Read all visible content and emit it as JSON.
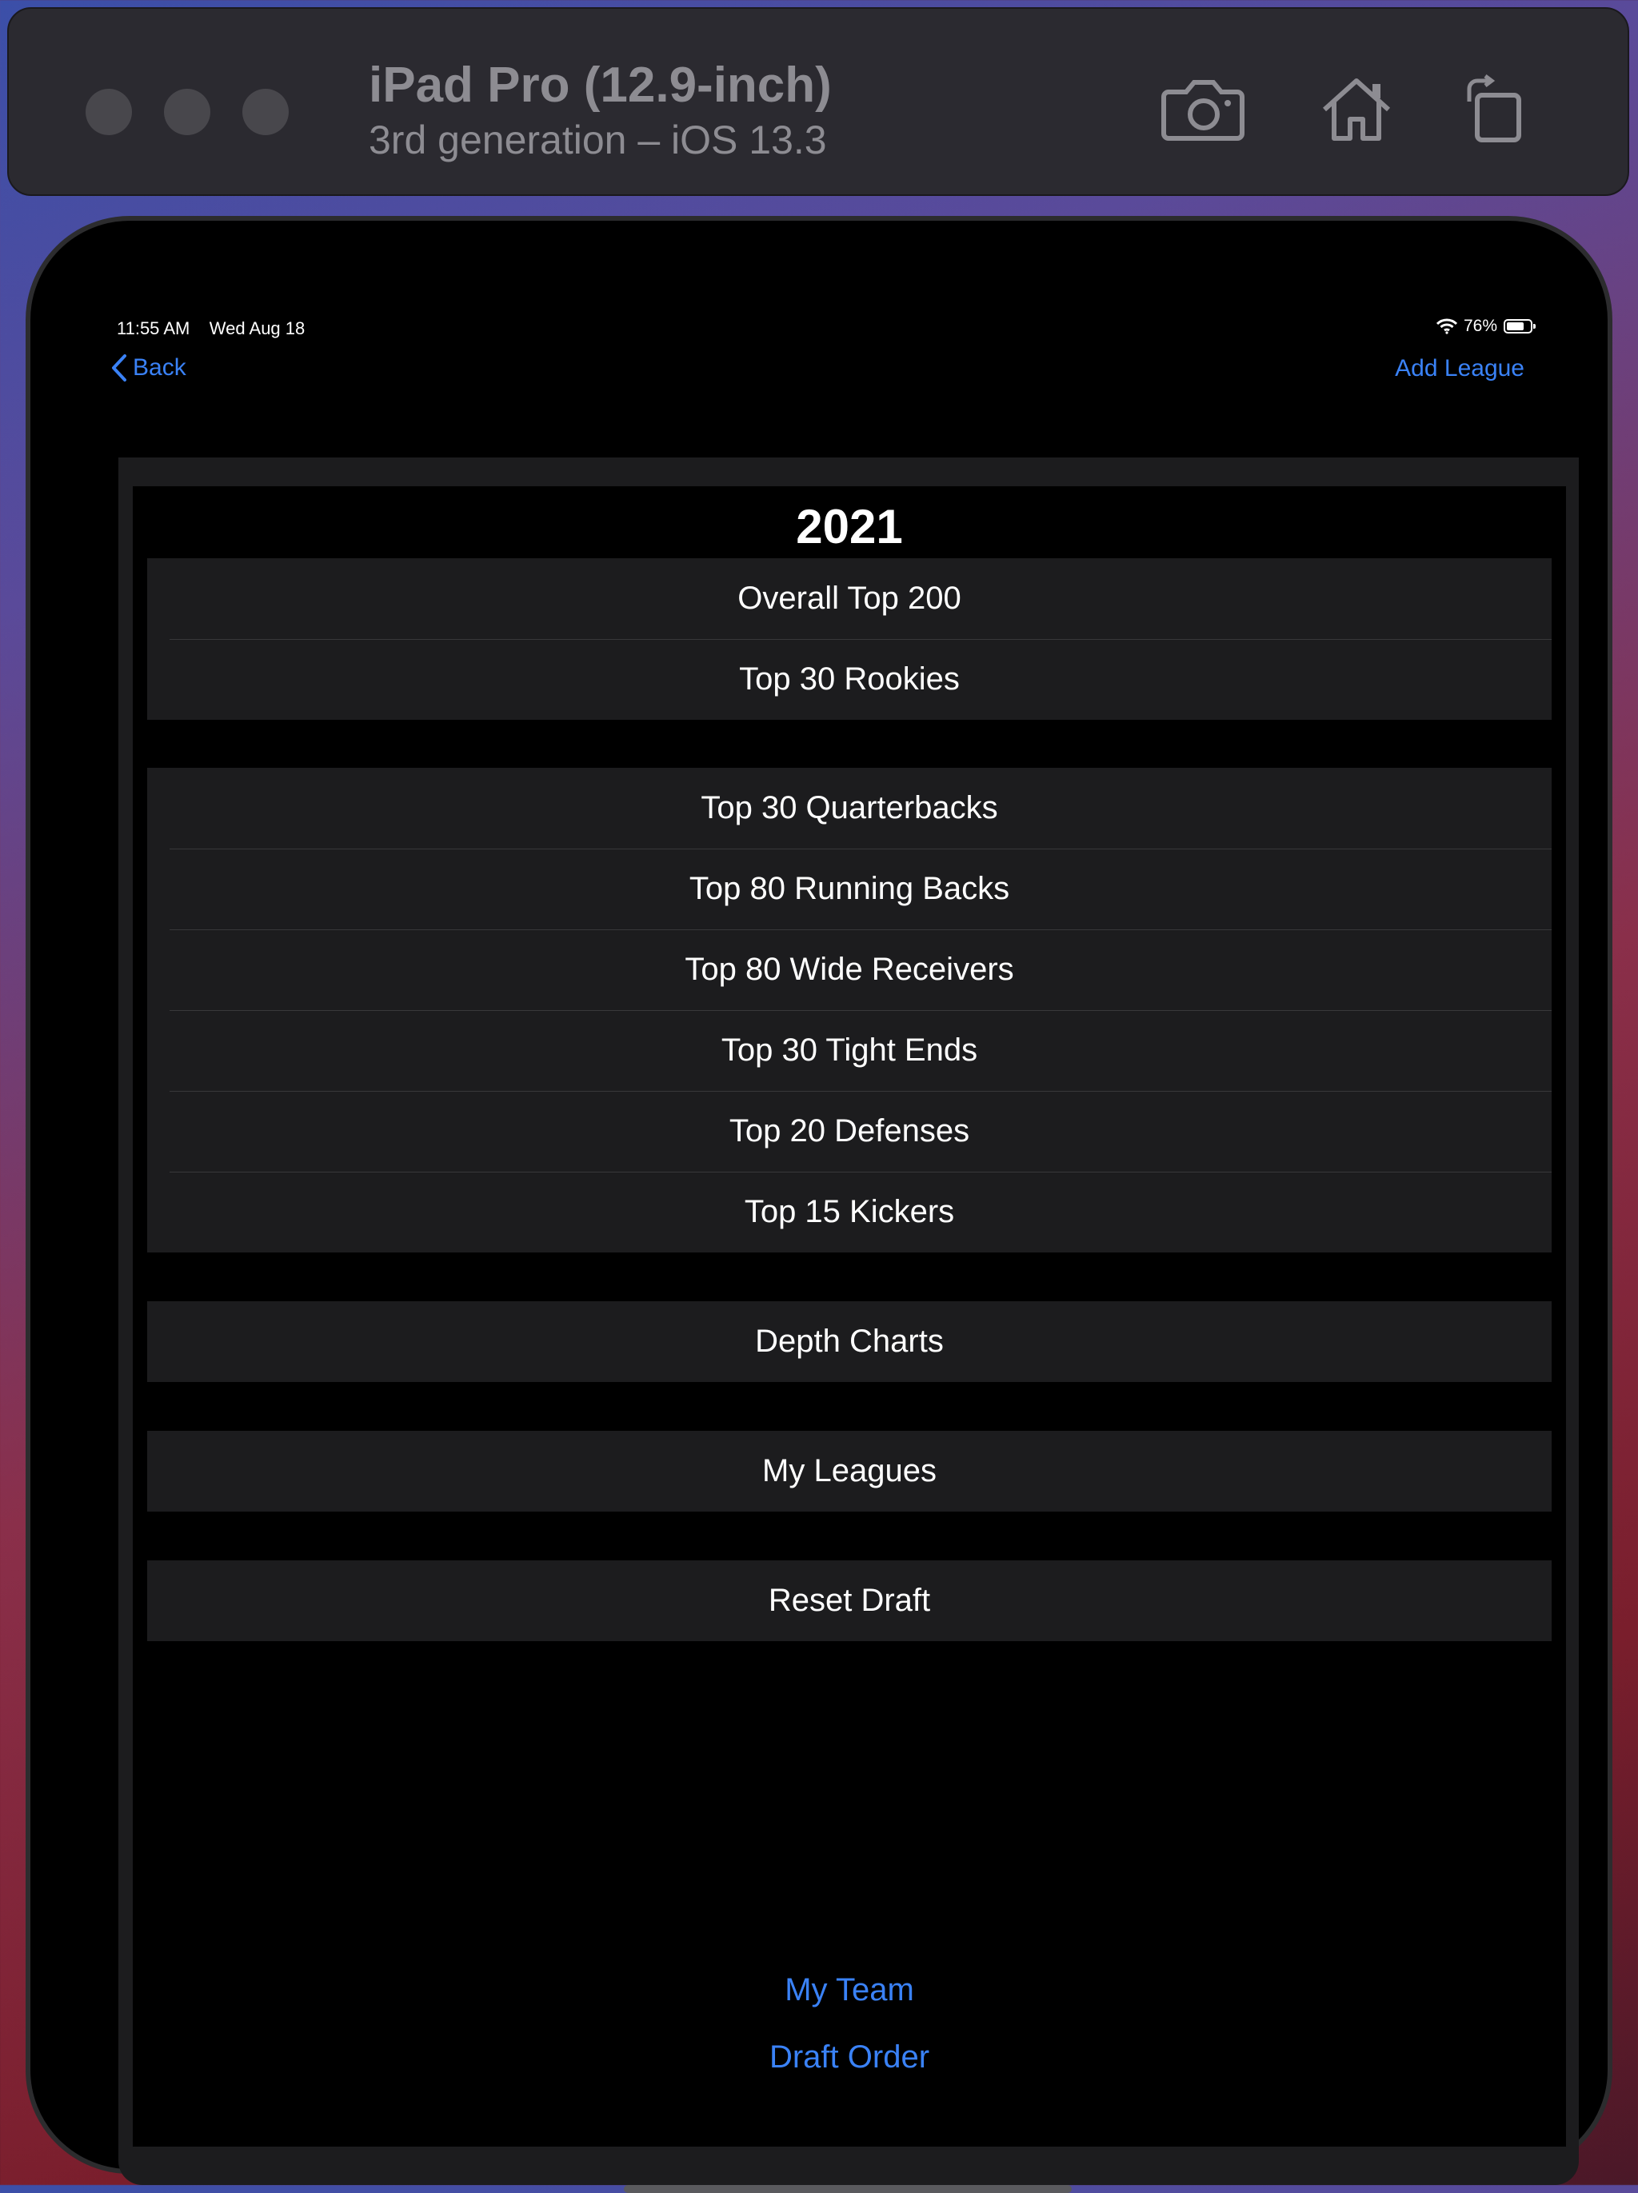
{
  "simulator": {
    "device_name": "iPad Pro (12.9-inch)",
    "device_detail": "3rd generation – iOS 13.3",
    "icons": [
      "camera-icon",
      "home-icon",
      "rotate-icon"
    ]
  },
  "status_bar": {
    "time": "11:55 AM",
    "date": "Wed Aug 18",
    "battery": "76%",
    "battery_level": 0.76
  },
  "nav": {
    "back_label": "Back",
    "add_label": "Add League"
  },
  "main": {
    "year": "2021",
    "groups": [
      [
        "Overall Top 200",
        "Top 30 Rookies"
      ],
      [
        "Top 30 Quarterbacks",
        "Top 80 Running Backs",
        "Top 80 Wide Receivers",
        "Top 30 Tight Ends",
        "Top 20 Defenses",
        "Top 15 Kickers"
      ],
      [
        "Depth Charts"
      ],
      [
        "My Leagues"
      ],
      [
        "Reset Draft"
      ]
    ],
    "links": [
      "My Team",
      "Draft Order"
    ]
  },
  "colors": {
    "accent": "#3a82f7",
    "cell_bg": "#1c1c1e",
    "background": "#000000"
  }
}
